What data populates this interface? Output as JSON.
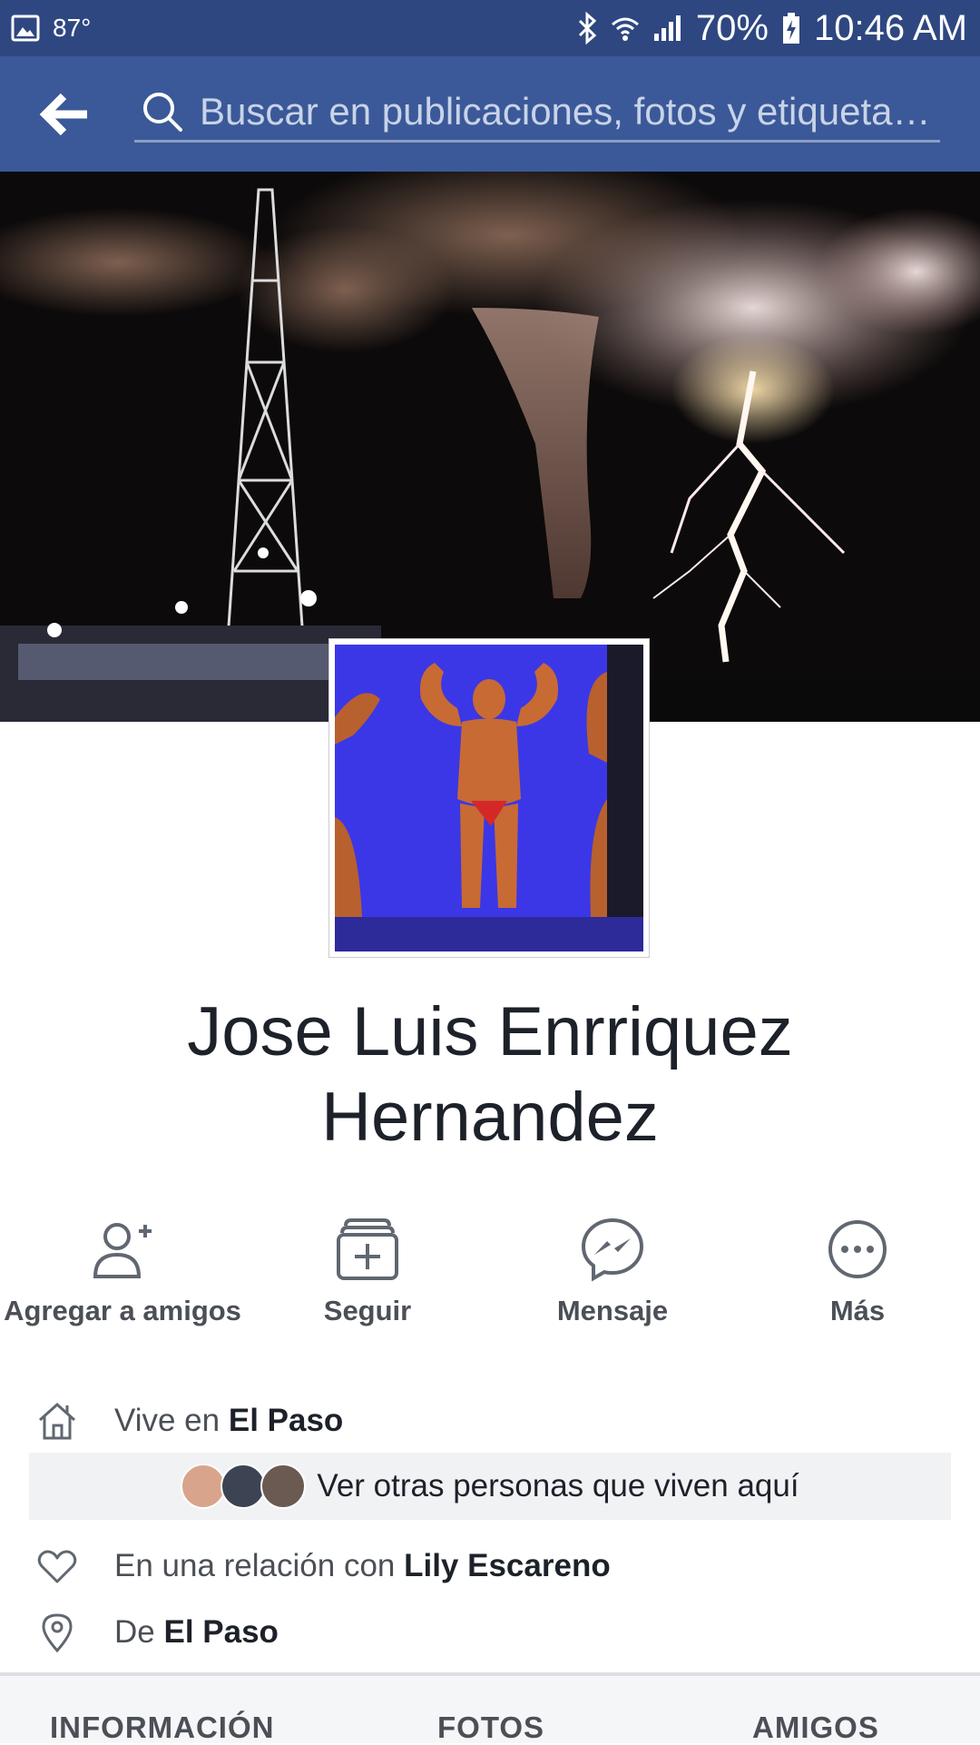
{
  "status_bar": {
    "temperature": "87°",
    "battery": "70%",
    "time": "10:46 AM",
    "icons": [
      "image-icon",
      "bluetooth-icon",
      "wifi-icon",
      "signal-icon",
      "battery-charging-icon"
    ]
  },
  "header": {
    "search_placeholder": "Buscar en publicaciones, fotos y etiqueta…",
    "background_color": "#3b5998"
  },
  "profile": {
    "name_line1": "Jose Luis Enrriquez",
    "name_line2": "Hernandez"
  },
  "actions": [
    {
      "label": "Agregar a amigos",
      "icon": "add-friend-icon"
    },
    {
      "label": "Seguir",
      "icon": "follow-icon"
    },
    {
      "label": "Mensaje",
      "icon": "messenger-icon"
    },
    {
      "label": "Más",
      "icon": "more-icon"
    }
  ],
  "info": {
    "lives_prefix": "Vive en ",
    "lives_place": "El Paso",
    "see_others": "Ver otras personas que viven aquí",
    "relationship_prefix": "En una relación con ",
    "relationship_name": "Lily Escareno",
    "from_prefix": "De ",
    "from_place": "El Paso"
  },
  "tabs": [
    {
      "label": "INFORMACIÓN"
    },
    {
      "label": "FOTOS"
    },
    {
      "label": "AMIGOS"
    }
  ]
}
